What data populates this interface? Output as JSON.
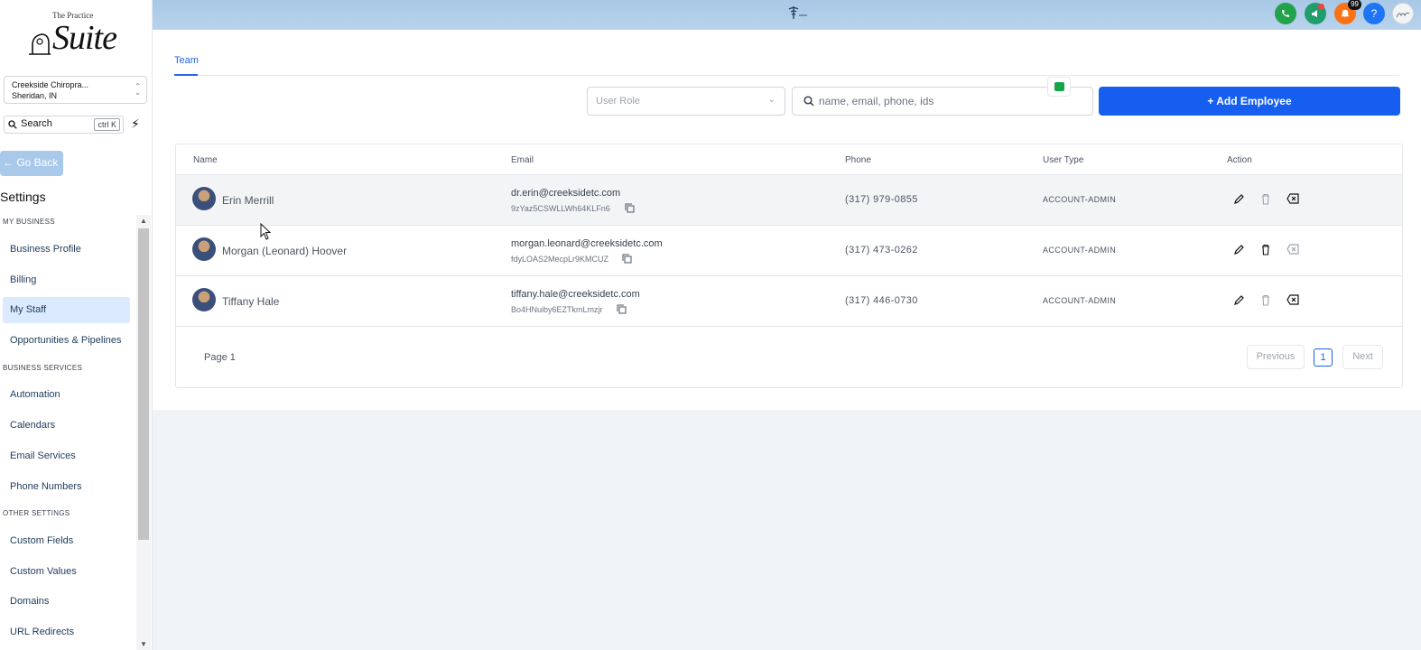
{
  "brand": {
    "top": "The Practice",
    "main": "Suite"
  },
  "location": {
    "name": "Creekside Chiropra...",
    "city": "Sheridan, IN"
  },
  "sidebar": {
    "search_label": "Search",
    "search_shortcut": "ctrl K",
    "go_back": "← Go Back",
    "title": "Settings",
    "sections": [
      {
        "label": "MY BUSINESS",
        "items": [
          "Business Profile",
          "Billing",
          "My Staff",
          "Opportunities & Pipelines"
        ]
      },
      {
        "label": "BUSINESS SERVICES",
        "items": [
          "Automation",
          "Calendars",
          "Email Services",
          "Phone Numbers"
        ]
      },
      {
        "label": "OTHER SETTINGS",
        "items": [
          "Custom Fields",
          "Custom Values",
          "Domains",
          "URL Redirects"
        ]
      }
    ],
    "active_item": "My Staff"
  },
  "topbar": {
    "notification_count": "99",
    "help": "?"
  },
  "page": {
    "tab": "Team",
    "role_placeholder": "User Role",
    "search_placeholder": "name, email, phone, ids",
    "add_button": "Add Employee"
  },
  "table": {
    "columns": [
      "Name",
      "Email",
      "Phone",
      "User Type",
      "Action"
    ],
    "rows": [
      {
        "name": "Erin Merrill",
        "email": "dr.erin@creeksidetc.com",
        "id": "9zYaz5CSWLLWh64KLFn6",
        "phone": "(317) 979-0855",
        "type": "ACCOUNT-ADMIN"
      },
      {
        "name": "Morgan (Leonard) Hoover",
        "email": "morgan.leonard@creeksidetc.com",
        "id": "fdyLOAS2MecpLr9KMCUZ",
        "phone": "(317) 473-0262",
        "type": "ACCOUNT-ADMIN"
      },
      {
        "name": "Tiffany Hale",
        "email": "tiffany.hale@creeksidetc.com",
        "id": "Bo4HNuiby6EZTkmLmzjr",
        "phone": "(317) 446-0730",
        "type": "ACCOUNT-ADMIN"
      }
    ]
  },
  "pagination": {
    "label": "Page 1",
    "previous": "Previous",
    "current": "1",
    "next": "Next"
  },
  "colors": {
    "primary": "#155eef",
    "active_nav": "#dbeafe",
    "topbar": "#a8c8e6"
  }
}
